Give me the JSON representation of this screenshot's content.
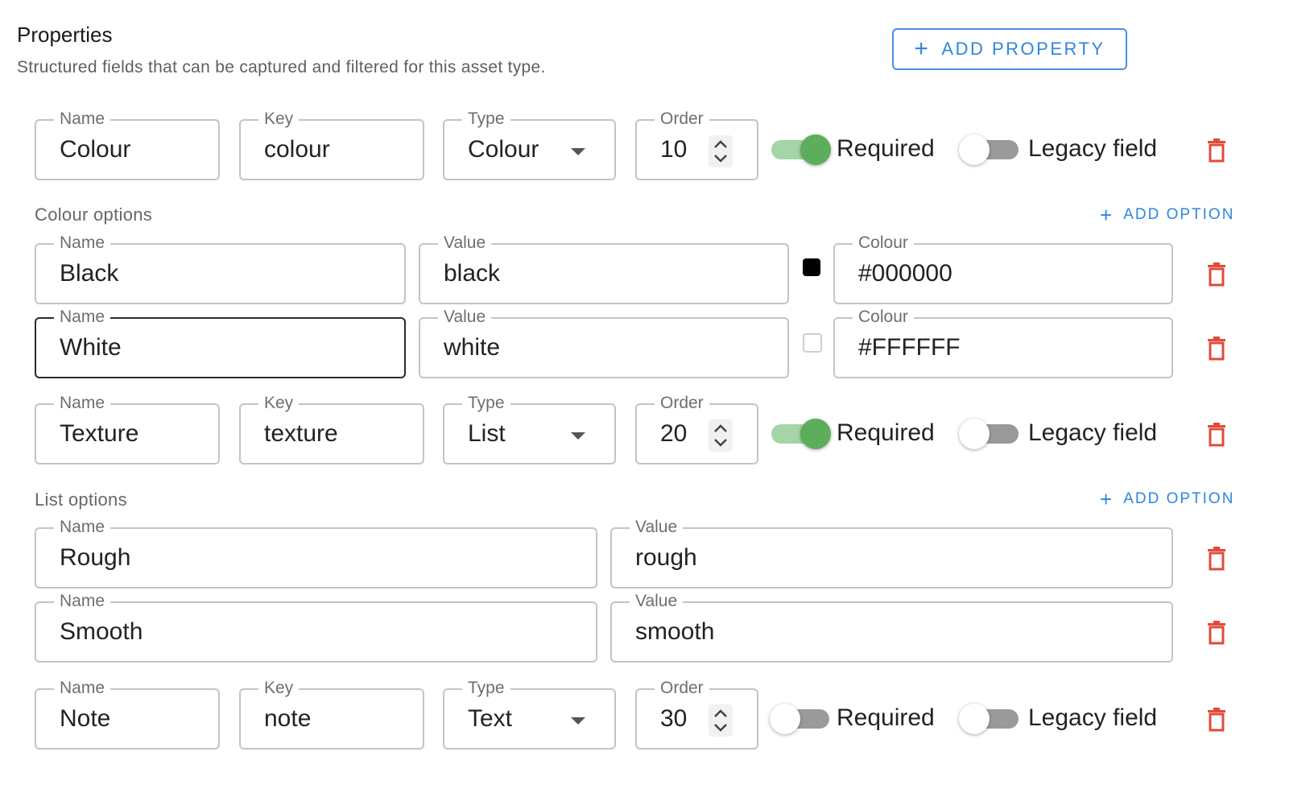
{
  "header": {
    "title": "Properties",
    "subtitle": "Structured fields that can be captured and filtered for this asset type.",
    "add_property_label": "ADD PROPERTY"
  },
  "labels": {
    "name": "Name",
    "key": "Key",
    "type": "Type",
    "order": "Order",
    "value": "Value",
    "colour": "Colour",
    "required": "Required",
    "legacy": "Legacy field",
    "add_option": "ADD OPTION"
  },
  "properties": [
    {
      "name": "Colour",
      "key": "colour",
      "type": "Colour",
      "order": "10",
      "required": true,
      "legacy": false,
      "options_label": "Colour options",
      "options": [
        {
          "name": "Black",
          "value": "black",
          "colour": "#000000"
        },
        {
          "name": "White",
          "value": "white",
          "colour": "#FFFFFF"
        }
      ]
    },
    {
      "name": "Texture",
      "key": "texture",
      "type": "List",
      "order": "20",
      "required": true,
      "legacy": false,
      "options_label": "List options",
      "options": [
        {
          "name": "Rough",
          "value": "rough"
        },
        {
          "name": "Smooth",
          "value": "smooth"
        }
      ]
    },
    {
      "name": "Note",
      "key": "note",
      "type": "Text",
      "order": "30",
      "required": false,
      "legacy": false
    }
  ],
  "colors": {
    "accent": "#2f86e0",
    "switch_on": "#5cae5d",
    "delete": "#e04b3c"
  }
}
